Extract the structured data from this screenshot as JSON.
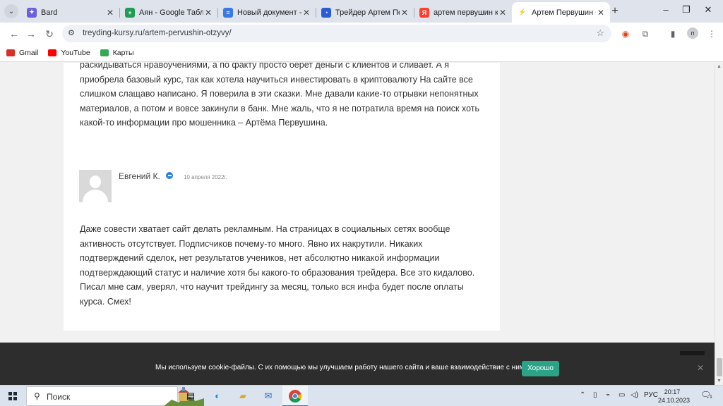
{
  "tabs": [
    {
      "title": "Bard",
      "color": "#6b5fe0",
      "glyph": "✦",
      "active": false
    },
    {
      "title": "Аян - Google Таблиц",
      "color": "#1f9d55",
      "glyph": "+",
      "active": false
    },
    {
      "title": "Новый документ - G",
      "color": "#3b78e7",
      "glyph": "≡",
      "active": false
    },
    {
      "title": "Трейдер Артем Перв",
      "color": "#2d5bd8",
      "glyph": "◔",
      "active": false
    },
    {
      "title": "артем первушин ку",
      "color": "#ff3d2e",
      "glyph": "Я",
      "active": false
    },
    {
      "title": "Артем Первушин О",
      "color": "#ffffff",
      "glyph": "⚡",
      "active": true
    }
  ],
  "url": "treyding-kursy.ru/artem-pervushin-otzyvy/",
  "profile_initial": "п",
  "bookmarks": [
    {
      "label": "Gmail",
      "color": "#d93025"
    },
    {
      "label": "YouTube",
      "color": "#ff0000"
    },
    {
      "label": "Карты",
      "color": "#34a853"
    }
  ],
  "review1_text": "раскидываться нравоучениями, а по факту просто берет деньги с клиентов и сливает. А я приобрела базовый курс, так как хотела научиться инвестировать в криптовалюту На сайте все слишком слащаво написано. Я поверила в эти сказки. Мне давали какие-то отрывки непонятных материалов, а потом и вовсе закинули в банк. Мне жаль, что я не потратила время на поиск хоть какой-то информации про мошенника – Артёма Первушина.",
  "review2": {
    "author": "Евгений К.",
    "date": "10 апреля 2022г.",
    "text": "Даже совести хватает сайт делать рекламным. На страницах в социальных сетях вообще активность отсутствует. Подписчиков почему-то много. Явно их накрутили. Никаких подтверждений сделок, нет результатов учеников, нет абсолютно никакой информации подтверждающий статус и наличие хотя бы какого-то образования трейдера. Все это кидалово. Писал мне сам, уверял, что научит трейдингу за месяц, только вся инфа будет после оплаты курса. Смех!"
  },
  "cookie": {
    "text": "Мы используем cookie-файлы. С их помощью мы улучшаем работу нашего сайта и ваше взаимодействие с ним.",
    "button": "Хорошо",
    "accent": "#2aa387"
  },
  "taskbar": {
    "search_label": "Поиск",
    "lang": "РУС",
    "time": "20:17",
    "date": "24.10.2023",
    "notification_count": "1"
  }
}
